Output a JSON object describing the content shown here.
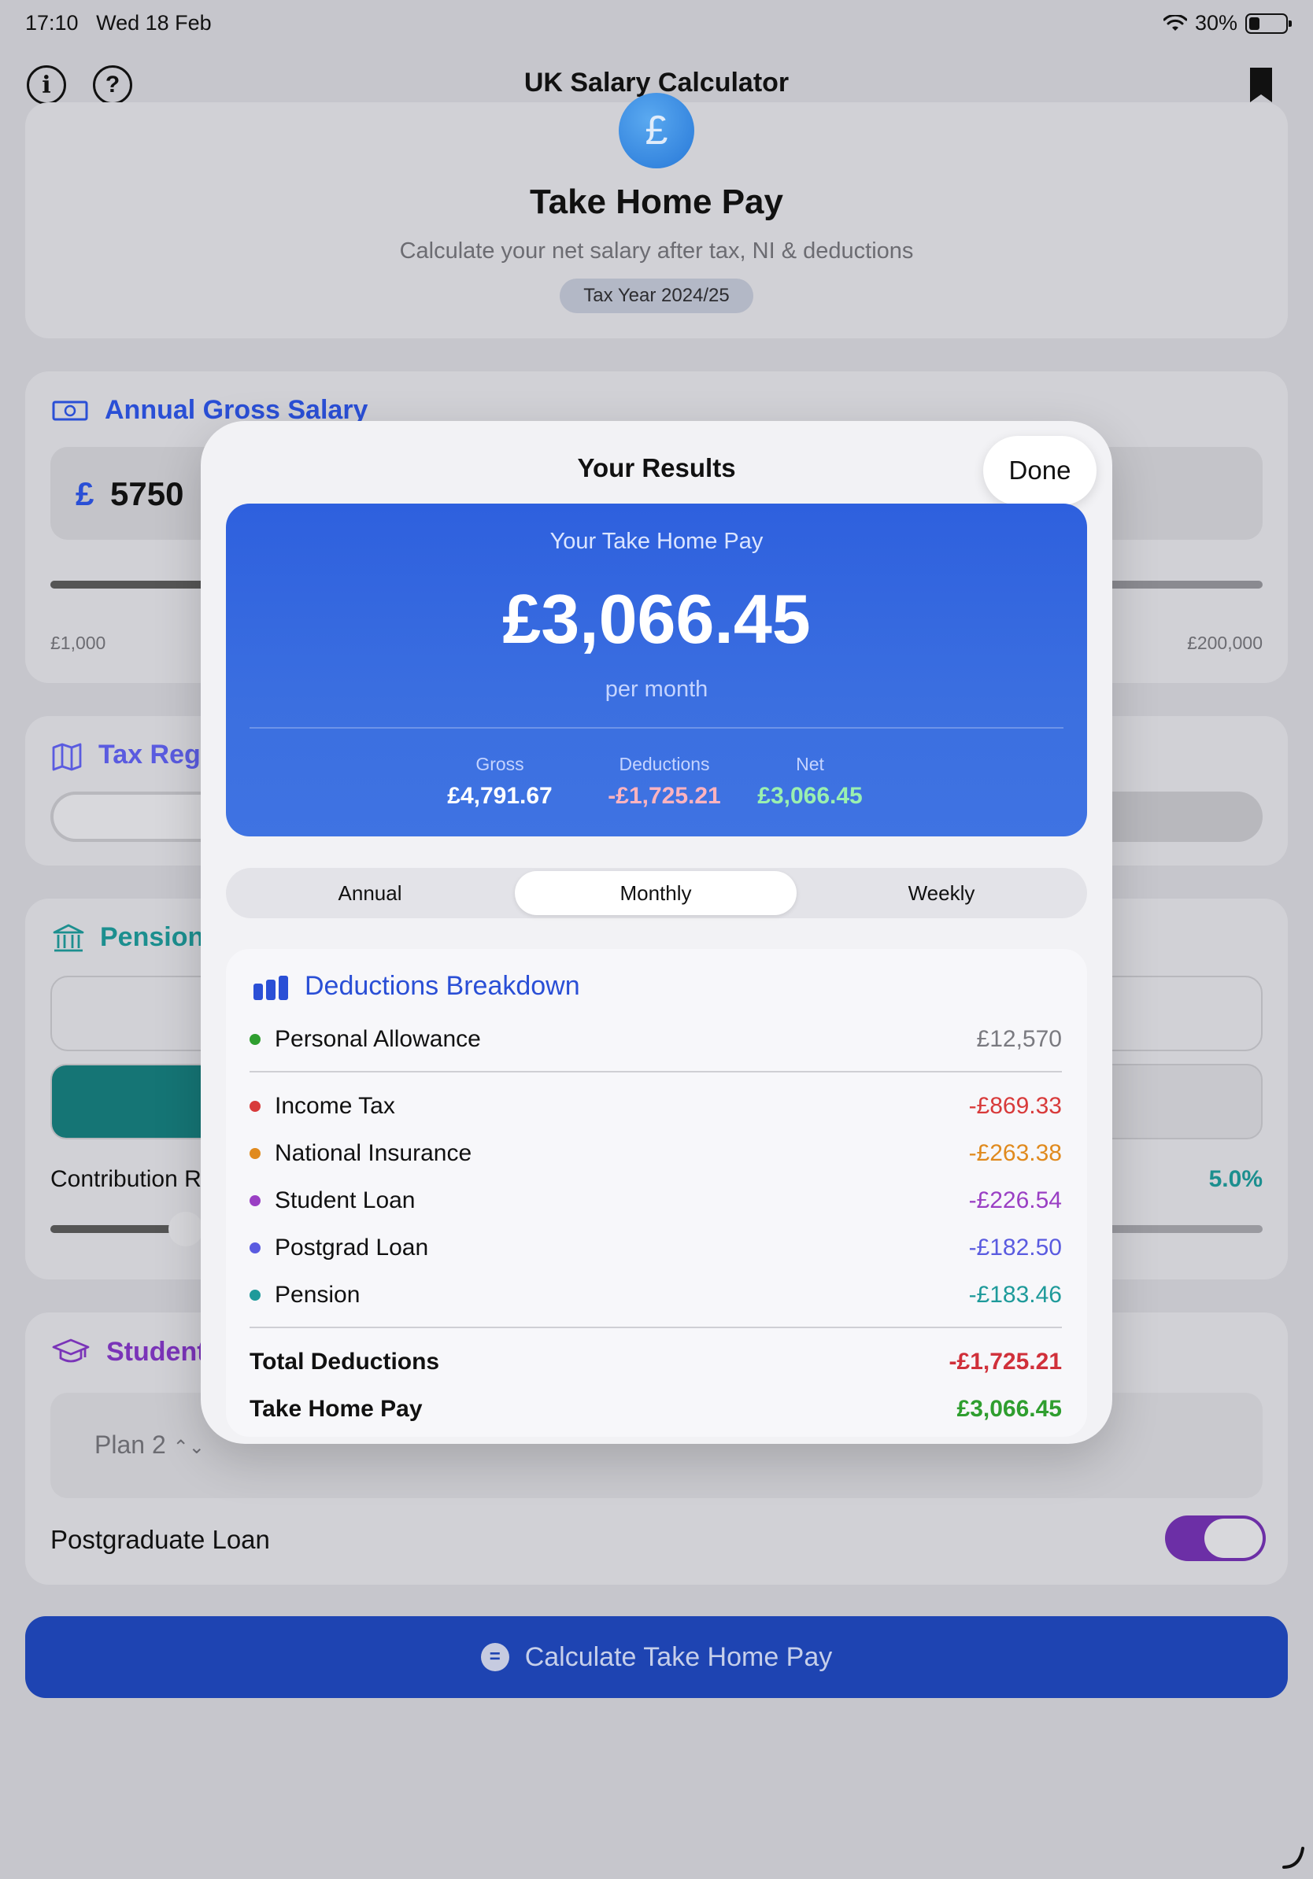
{
  "status_bar": {
    "time": "17:10",
    "date": "Wed 18 Feb",
    "battery": "30%",
    "battery_level": 0.3
  },
  "nav": {
    "title": "UK Salary Calculator",
    "info_icon": "info-icon",
    "help_icon": "help-icon",
    "bookmark_icon": "bookmark-icon"
  },
  "header": {
    "title": "Take Home Pay",
    "subtitle": "Calculate your net salary after tax, NI & deductions",
    "tax_year": "Tax Year 2024/25",
    "logo_symbol": "£"
  },
  "salary": {
    "label": "Annual Gross Salary",
    "currency": "£",
    "value": "5750",
    "min": "£1,000",
    "max": "£200,000"
  },
  "region": {
    "label": "Tax Regi"
  },
  "pension": {
    "label": "Pension",
    "contribution_label": "Contribution R",
    "contribution_value": "5.0%"
  },
  "student": {
    "label": "Student",
    "plan": "Plan 2",
    "postgrad_label": "Postgraduate Loan",
    "postgrad_on": true
  },
  "calculate_button": "Calculate Take Home Pay",
  "modal": {
    "title": "Your Results",
    "done": "Done",
    "hero": {
      "label": "Your Take Home Pay",
      "amount": "£3,066.45",
      "period": "per month",
      "gross_label": "Gross",
      "gross": "£4,791.67",
      "deductions_label": "Deductions",
      "deductions": "-£1,725.21",
      "net_label": "Net",
      "net": "£3,066.45"
    },
    "tabs": [
      "Annual",
      "Monthly",
      "Weekly"
    ],
    "active_tab": "Monthly",
    "breakdown": {
      "title": "Deductions Breakdown",
      "allowance": {
        "label": "Personal Allowance",
        "value": "£12,570",
        "color": "#2f9e2f"
      },
      "items": [
        {
          "label": "Income Tax",
          "value": "-£869.33",
          "color": "#d83a3a"
        },
        {
          "label": "National Insurance",
          "value": "-£263.38",
          "color": "#e08a1e"
        },
        {
          "label": "Student Loan",
          "value": "-£226.54",
          "color": "#9a3fc4"
        },
        {
          "label": "Postgrad Loan",
          "value": "-£182.50",
          "color": "#5a5be0"
        },
        {
          "label": "Pension",
          "value": "-£183.46",
          "color": "#1e9a9a"
        }
      ],
      "total_label": "Total Deductions",
      "total_value": "-£1,725.21",
      "take_home_label": "Take Home Pay",
      "take_home_value": "£3,066.45"
    }
  },
  "colors": {
    "accent": "#2a4fd6",
    "teal": "#1c8f8f",
    "purple": "#7a34b8",
    "green": "#2f9e2f",
    "red": "#d0303a"
  }
}
